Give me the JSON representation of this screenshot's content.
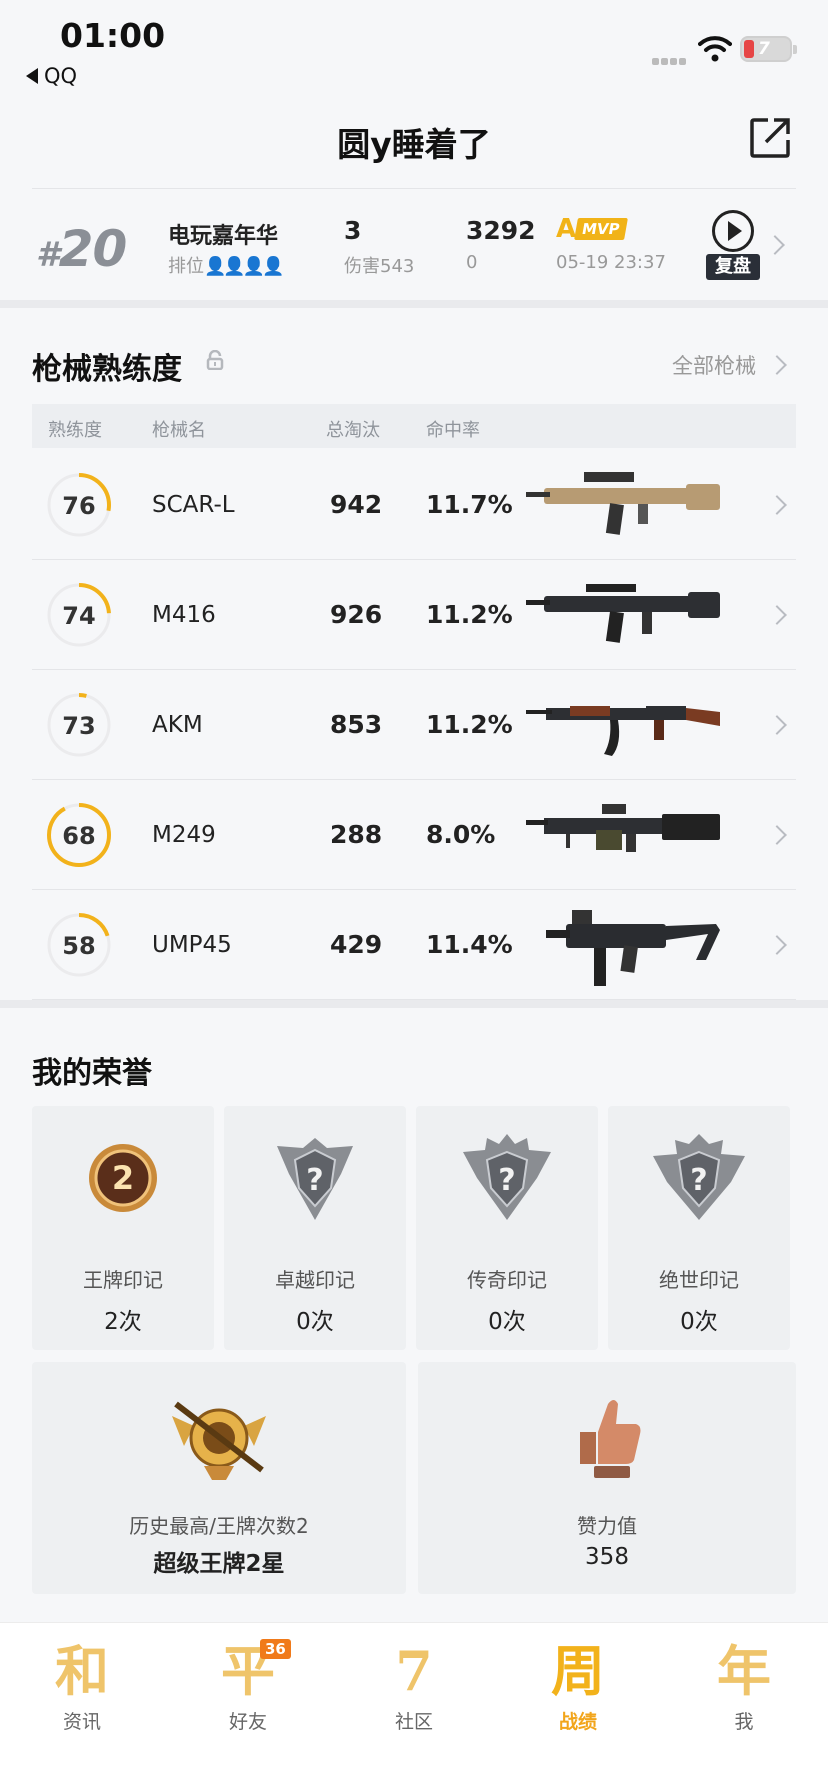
{
  "status_bar": {
    "time": "01:00",
    "back_app": "QQ",
    "battery": "7"
  },
  "header": {
    "title": "圆y睡着了"
  },
  "match": {
    "rank": "20",
    "mode": "电玩嘉年华",
    "position_label": "排位",
    "kills": "3",
    "damage": "伤害543",
    "score": "3292",
    "score_sub": "0",
    "grade": "A",
    "mvp": "MVP",
    "time": "05-19 23:37",
    "replay_label": "复盘"
  },
  "weapons": {
    "title": "枪械熟练度",
    "all_link": "全部枪械",
    "headers": [
      "熟练度",
      "枪械名",
      "总淘汰",
      "命中率"
    ],
    "rows": [
      {
        "proficiency": "76",
        "progress": 0.28,
        "name": "SCAR-L",
        "kills": "942",
        "hit_rate": "11.7%"
      },
      {
        "proficiency": "74",
        "progress": 0.24,
        "name": "M416",
        "kills": "926",
        "hit_rate": "11.2%"
      },
      {
        "proficiency": "73",
        "progress": 0.04,
        "name": "AKM",
        "kills": "853",
        "hit_rate": "11.2%"
      },
      {
        "proficiency": "68",
        "progress": 0.92,
        "name": "M249",
        "kills": "288",
        "hit_rate": "8.0%"
      },
      {
        "proficiency": "58",
        "progress": 0.2,
        "name": "UMP45",
        "kills": "429",
        "hit_rate": "11.4%"
      }
    ]
  },
  "honors": {
    "title": "我的荣誉",
    "marks": [
      {
        "label": "王牌印记",
        "count": "2次",
        "badge_number": "2"
      },
      {
        "label": "卓越印记",
        "count": "0次",
        "badge_number": "?"
      },
      {
        "label": "传奇印记",
        "count": "0次",
        "badge_number": "?"
      },
      {
        "label": "绝世印记",
        "count": "0次",
        "badge_number": "?"
      }
    ],
    "highest": {
      "label": "历史最高/王牌次数2",
      "value": "超级王牌2星"
    },
    "likes": {
      "label": "赞力值",
      "value": "358"
    }
  },
  "tabbar": {
    "tabs": [
      {
        "glyph": "和",
        "label": "资讯"
      },
      {
        "glyph": "平",
        "label": "好友",
        "badge": "36"
      },
      {
        "glyph": "7",
        "label": "社区"
      },
      {
        "glyph": "周",
        "label": "战绩"
      },
      {
        "glyph": "年",
        "label": "我"
      }
    ],
    "active": "战绩"
  },
  "colors": {
    "accent": "#f2b21b",
    "ring_track": "#ebebed",
    "card_bg": "#eef0f2"
  }
}
